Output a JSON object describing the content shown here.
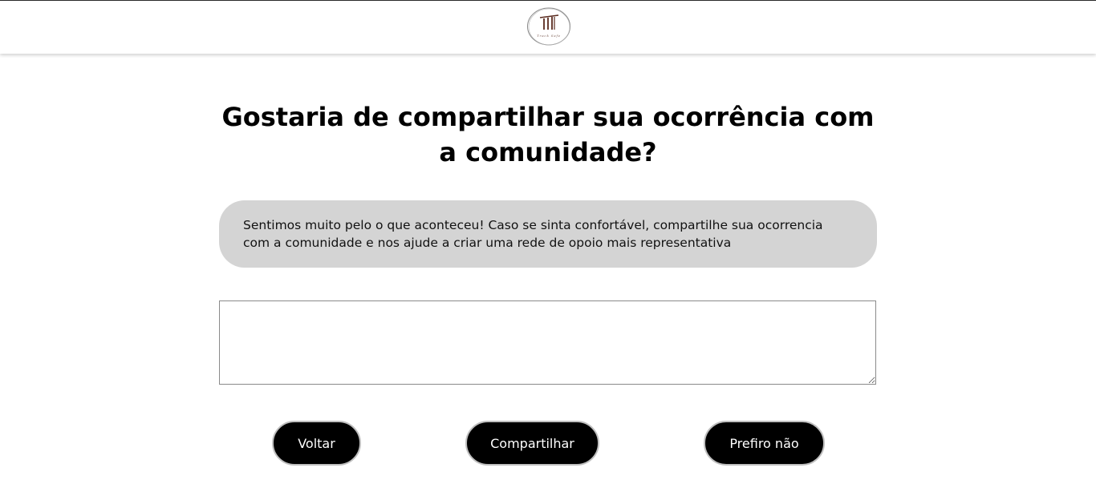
{
  "header": {
    "logo_text": "Track Safe"
  },
  "main": {
    "title": "Gostaria de compartilhar sua ocorrência com a comunidade?",
    "notice": "Sentimos muito pelo o que aconteceu! Caso se sinta confortável, compartilhe sua ocorrencia com a comunidade e nos ajude a criar uma rede de opoio mais representativa",
    "textarea_value": ""
  },
  "actions": {
    "back_label": "Voltar",
    "share_label": "Compartilhar",
    "decline_label": "Prefiro não"
  },
  "colors": {
    "button_bg": "#000000",
    "notice_bg": "#d4d4d4",
    "logo_brown": "#5a2a1e"
  }
}
